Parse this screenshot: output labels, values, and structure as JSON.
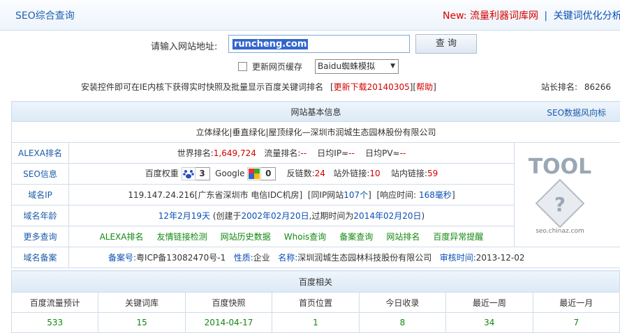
{
  "header": {
    "brand": "SEO综合查询",
    "new_label": "New:",
    "link1": "流量利器词库网",
    "sep": "|",
    "link2": "关键词优化分析"
  },
  "search": {
    "label": "请输入网站地址:",
    "value": "runcheng.com",
    "button": "查 询",
    "cache_label": "更新网页缓存",
    "engine_select": "Baidu蜘蛛模拟"
  },
  "notice": {
    "text": "安装控件即可在IE内核下获得实时快照及批量显示百度关键词排名",
    "bracket_open": "[",
    "download": "更新下载20140305",
    "mid": "][",
    "help": "帮助",
    "bracket_close": "]",
    "rank_label": "站长排名:",
    "rank_value": "86266"
  },
  "basic": {
    "header": "网站基本信息",
    "header_link": "SEO数据风向标",
    "site_title": "立体绿化|垂直绿化|屋顶绿化—深圳市润城生态园林股份有限公司",
    "alexa": {
      "label": "ALEXA排名",
      "world_label": "世界排名:",
      "world_value": "1,649,724",
      "traffic_label": "流量排名:",
      "traffic_value": "--",
      "ip_label": "日均IP≈",
      "ip_value": "--",
      "pv_label": "日均PV≈",
      "pv_value": "--"
    },
    "seo": {
      "label": "SEO信息",
      "baidu_label": "百度权重",
      "baidu_value": "3",
      "google_label": "Google",
      "google_value": "0",
      "backlinks_label": "反链数:",
      "backlinks_value": "24",
      "outlinks_label": "站外链接:",
      "outlinks_value": "10",
      "inlinks_label": "站内链接:",
      "inlinks_value": "59"
    },
    "ip": {
      "label": "域名IP",
      "value": "119.147.24.216[广东省深圳市 电信IDC机房]",
      "same_ip_open": "[同IP网站",
      "same_ip_value": "107个",
      "same_ip_close": "]",
      "resp_label": "[响应时间:",
      "resp_value": "168毫秒",
      "resp_close": "]"
    },
    "age": {
      "label": "域名年龄",
      "value": "12年2月19天",
      "created_label": "(创建于",
      "created_value": "2002年02月20日",
      "expire_label": ",过期时间为",
      "expire_value": "2014年02月20日",
      "close": ")"
    },
    "more": {
      "label": "更多查询",
      "links": [
        "ALEXA排名",
        "友情链接检测",
        "网站历史数据",
        "Whois查询",
        "备案查询",
        "网站排名",
        "百度异常提醒"
      ]
    },
    "icp": {
      "label": "域名备案",
      "no_label": "备案号:",
      "no_value": "粤ICP备13082470号-1",
      "nature_label": "性质:",
      "nature_value": "企业",
      "name_label": "名称:",
      "name_value": "深圳润城生态园林科技股份有限公司",
      "time_label": "审核时间:",
      "time_value": "2013-12-02"
    }
  },
  "logo": {
    "text": "TOOL",
    "caption": "seo.chinaz.com"
  },
  "baidu": {
    "header": "百度相关",
    "columns": [
      "百度流量预计",
      "关键词库",
      "百度快照",
      "首页位置",
      "今日收录",
      "最近一周",
      "最近一月"
    ],
    "values": [
      "533",
      "15",
      "2014-04-17",
      "1",
      "8",
      "34",
      "7"
    ]
  },
  "colors": {
    "link": "#1a5aa8",
    "red": "#d40000",
    "green": "#118811",
    "header_bg": "#dce9f6"
  }
}
